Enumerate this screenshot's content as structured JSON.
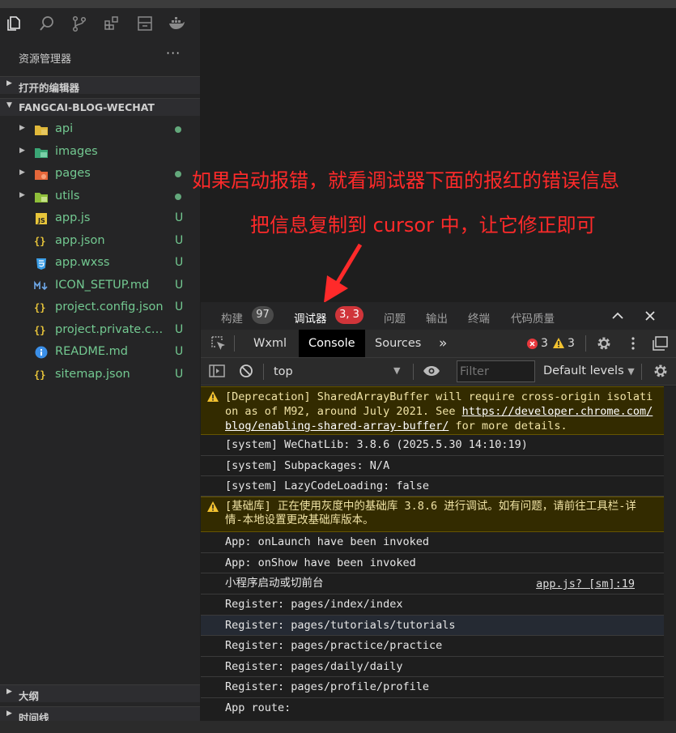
{
  "explorer": {
    "title": "资源管理器",
    "more": "···",
    "open_editors": "打开的编辑器",
    "project": "FANGCAI-BLOG-WECHAT",
    "outline": "大纲",
    "timeline": "时间线",
    "folders": [
      {
        "name": "api",
        "color": "#e0b83a"
      },
      {
        "name": "images",
        "color": "#3aa675"
      },
      {
        "name": "pages",
        "color": "#e5673a"
      },
      {
        "name": "utils",
        "color": "#8fbf3a"
      }
    ],
    "files": [
      {
        "name": "app.js",
        "status": "U",
        "icon": "js-icon"
      },
      {
        "name": "app.json",
        "status": "U",
        "icon": "json-icon"
      },
      {
        "name": "app.wxss",
        "status": "U",
        "icon": "css-icon"
      },
      {
        "name": "ICON_SETUP.md",
        "status": "U",
        "icon": "markdown-icon"
      },
      {
        "name": "project.config.json",
        "status": "U",
        "icon": "json-icon"
      },
      {
        "name": "project.private.co...",
        "status": "U",
        "icon": "json-icon"
      },
      {
        "name": "README.md",
        "status": "U",
        "icon": "info-icon"
      },
      {
        "name": "sitemap.json",
        "status": "U",
        "icon": "json-icon"
      }
    ]
  },
  "annotation": {
    "line1": "如果启动报错，就看调试器下面的报红的错误信息",
    "line2": "把信息复制到 cursor 中，让它修正即可",
    "color": "#ff2a2a"
  },
  "devtools": {
    "tabs": {
      "build": "构建",
      "build_count": "97",
      "debugger": "调试器",
      "debugger_count": "3, 3",
      "problems": "问题",
      "output": "输出",
      "terminal": "终端",
      "quality": "代码质量"
    },
    "panels": {
      "wxml": "Wxml",
      "console": "Console",
      "sources": "Sources",
      "more": "»",
      "errors": "3",
      "warnings": "3"
    },
    "filter": {
      "context": "top",
      "placeholder": "Filter",
      "levels": "Default levels"
    },
    "messages": [
      {
        "type": "warn",
        "text": "[Deprecation] SharedArrayBuffer will require cross-origin isolation as of M92, around July 2021. See ",
        "link": "https://developer.chrome.com/blog/enabling-shared-array-buffer/",
        "tail": " for more details."
      },
      {
        "type": "log",
        "text": "[system] WeChatLib: 3.8.6 (2025.5.30 14:10:19)"
      },
      {
        "type": "log",
        "text": "[system] Subpackages: N/A"
      },
      {
        "type": "log",
        "text": "[system] LazyCodeLoading: false"
      },
      {
        "type": "warn",
        "text": "[基础库] 正在使用灰度中的基础库 3.8.6 进行调试。如有问题，请前往工具栏-详情-本地设置更改基础库版本。"
      },
      {
        "type": "log",
        "text": "App: onLaunch have been invoked"
      },
      {
        "type": "log",
        "text": "App: onShow have been invoked"
      },
      {
        "type": "log",
        "text": "小程序启动或切前台",
        "source": "app.js? [sm]:19"
      },
      {
        "type": "log",
        "text": "Register: pages/index/index"
      },
      {
        "type": "log",
        "text": "Register: pages/tutorials/tutorials"
      },
      {
        "type": "log",
        "text": "Register: pages/practice/practice"
      },
      {
        "type": "log",
        "text": "Register: pages/daily/daily"
      },
      {
        "type": "log",
        "text": "Register: pages/profile/profile"
      },
      {
        "type": "log",
        "text": "App route:"
      }
    ]
  }
}
